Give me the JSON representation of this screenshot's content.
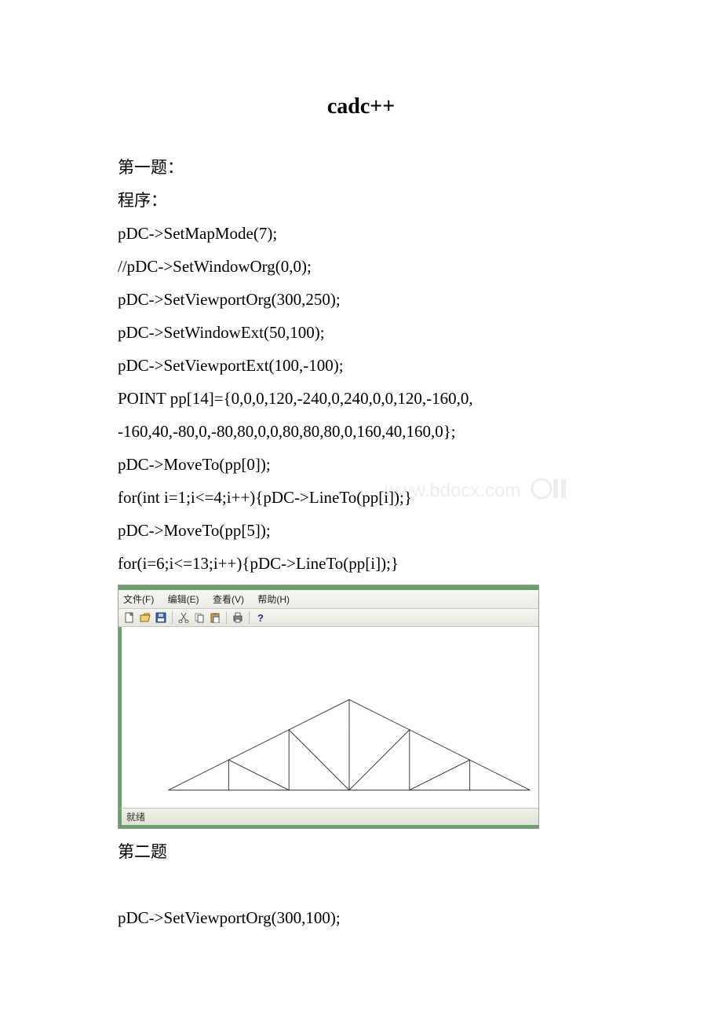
{
  "title": "cadc++",
  "lines": {
    "q1": "第一题：",
    "prog": "程序：",
    "c1": " pDC->SetMapMode(7);",
    "c2": " //pDC->SetWindowOrg(0,0);",
    "c3": " pDC->SetViewportOrg(300,250);",
    "c4": " pDC->SetWindowExt(50,100);",
    "c5": " pDC->SetViewportExt(100,-100);",
    "c6": " POINT pp[14]={0,0,0,120,-240,0,240,0,0,120,-160,0,",
    "c7": "  -160,40,-80,0,-80,80,0,0,80,80,80,0,160,40,160,0};",
    "c8": " pDC->MoveTo(pp[0]);",
    "c9": " for(int i=1;i<=4;i++){pDC->LineTo(pp[i]);}",
    "c10": " pDC->MoveTo(pp[5]);",
    "c11": " for(i=6;i<=13;i++){pDC->LineTo(pp[i]);}",
    "q2": "第二题",
    "c12": " pDC->SetViewportOrg(300,100);"
  },
  "screenshot": {
    "menu": {
      "file": "文件(F)",
      "edit": "编辑(E)",
      "view": "查看(V)",
      "help": "帮助(H)"
    },
    "status": "就绪",
    "icons": {
      "new": "new-icon",
      "open": "open-icon",
      "save": "save-icon",
      "cut": "cut-icon",
      "copy": "copy-icon",
      "paste": "paste-icon",
      "print": "print-icon",
      "help": "help-icon"
    }
  },
  "watermark_text": "www.bdocx.com"
}
